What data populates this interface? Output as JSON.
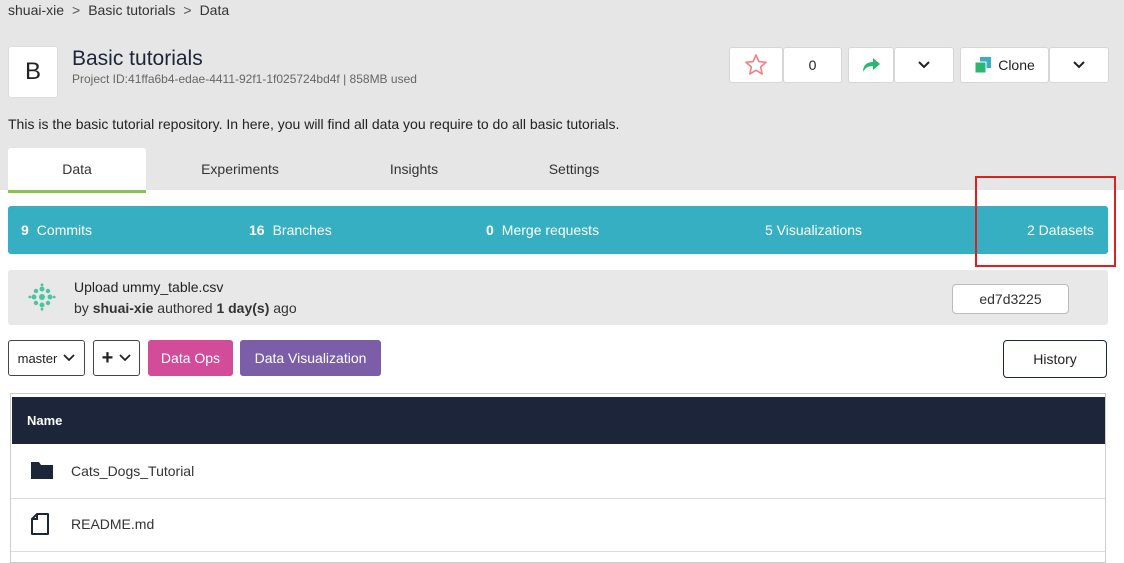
{
  "breadcrumb": [
    "shuai-xie",
    "Basic tutorials",
    "Data"
  ],
  "project": {
    "avatar_letter": "B",
    "title": "Basic tutorials",
    "meta": "Project ID:41ffa6b4-edae-4411-92f1-1f025724bd4f | 858MB used",
    "description": "This is the basic tutorial repository. In here, you will find all data you require to do all basic tutorials."
  },
  "actions": {
    "star_count": "0",
    "clone_label": "Clone"
  },
  "tabs": [
    {
      "label": "Data",
      "active": true
    },
    {
      "label": "Experiments",
      "active": false
    },
    {
      "label": "Insights",
      "active": false
    },
    {
      "label": "Settings",
      "active": false
    }
  ],
  "stats": {
    "commits_num": "9",
    "commits_label": "Commits",
    "branches_num": "16",
    "branches_label": "Branches",
    "merge_num": "0",
    "merge_label": "Merge requests",
    "visualizations": "5 Visualizations",
    "datasets": "2 Datasets"
  },
  "commit": {
    "message": "Upload ummy_table.csv",
    "by_prefix": "by",
    "author": "shuai-xie",
    "authored": "authored",
    "when": "1 day(s)",
    "ago": "ago",
    "sha": "ed7d3225"
  },
  "toolbar": {
    "branch": "master",
    "add": "+",
    "data_ops": "Data Ops",
    "data_viz": "Data Visualization",
    "history": "History"
  },
  "files": {
    "header": "Name",
    "rows": [
      {
        "name": "Cats_Dogs_Tutorial",
        "icon": "folder-icon"
      },
      {
        "name": "README.md",
        "icon": "file-icon"
      }
    ]
  },
  "colors": {
    "accent_teal": "#36afc3",
    "data_ops": "#d34c9a",
    "data_viz": "#7b5ea7",
    "header_navy": "#1c2539",
    "active_tab_underline": "#8bc34a",
    "highlight": "#e02020"
  }
}
